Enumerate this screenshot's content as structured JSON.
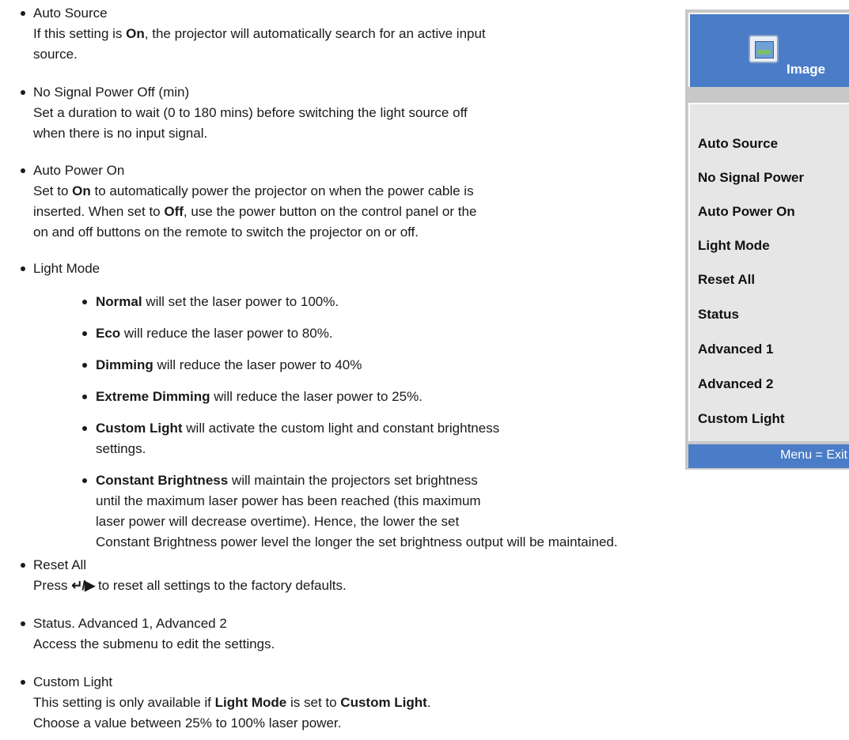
{
  "doc": {
    "auto_source": {
      "title": "Auto Source",
      "desc_pre": "If this setting is ",
      "desc_bold": "On",
      "desc_post": ", the projector will automatically search for an active input",
      "desc_line2": "source."
    },
    "no_signal": {
      "title": "No Signal Power Off (min)",
      "line1": "Set a duration to wait (0 to 180 mins) before switching the light source off",
      "line2": "when there is no input signal."
    },
    "auto_power_on": {
      "title": "Auto Power On",
      "l1_pre": "Set to ",
      "l1_bold": "On",
      "l1_post": " to automatically power the projector on when the power cable is",
      "l2_pre": "inserted. When set to ",
      "l2_bold": "Off",
      "l2_post": ", use the power button on the control panel or the",
      "l3": "on and off buttons on the remote to switch the projector on or off."
    },
    "light_mode": {
      "title": "Light Mode",
      "normal_bold": "Normal",
      "normal_text": " will set the laser power to 100%.",
      "eco_bold": "Eco",
      "eco_text": " will reduce the laser power to 80%.",
      "dimming_bold": "Dimming",
      "dimming_text": " will reduce the laser power to 40%",
      "extreme_bold": "Extreme Dimming",
      "extreme_text": " will reduce the laser power to 25%.",
      "custom_bold": "Custom Light",
      "custom_text": " will activate the custom light and constant brightness",
      "custom_line2": "settings.",
      "constant_bold": "Constant Brightness",
      "constant_text": " will maintain the projectors set brightness",
      "constant_line2": "until the maximum laser power has been reached (this maximum",
      "constant_line3": "laser power will decrease overtime). Hence, the lower the set",
      "constant_line4": "Constant Brightness power level the longer the set brightness output will be maintained."
    },
    "reset_all": {
      "title": "Reset All",
      "pre": "Press ",
      "glyph": "↵/▶",
      "post": " to reset all settings to the factory defaults."
    },
    "status": {
      "title": "Status. Advanced 1, Advanced 2",
      "desc": "Access the submenu to edit the settings."
    },
    "custom_light": {
      "title": "Custom Light",
      "l1_pre": "This setting is only available if ",
      "l1_bold1": "Light Mode",
      "l1_mid": " is set to ",
      "l1_bold2": "Custom Light",
      "l1_post": ".",
      "l2": "Choose a value between 25% to 100% laser power."
    }
  },
  "menu": {
    "title": "Image",
    "icon": "image-icon",
    "items": [
      "Auto Source",
      "No Signal Power",
      "Auto Power On",
      "Light Mode",
      "Reset All",
      "Status",
      "Advanced 1",
      "Advanced 2",
      "Custom Light"
    ],
    "footer": "Menu = Exit",
    "colors": {
      "header": "#4a7cc7",
      "panel": "#c8c8c8",
      "body": "#e6e6e6"
    }
  }
}
